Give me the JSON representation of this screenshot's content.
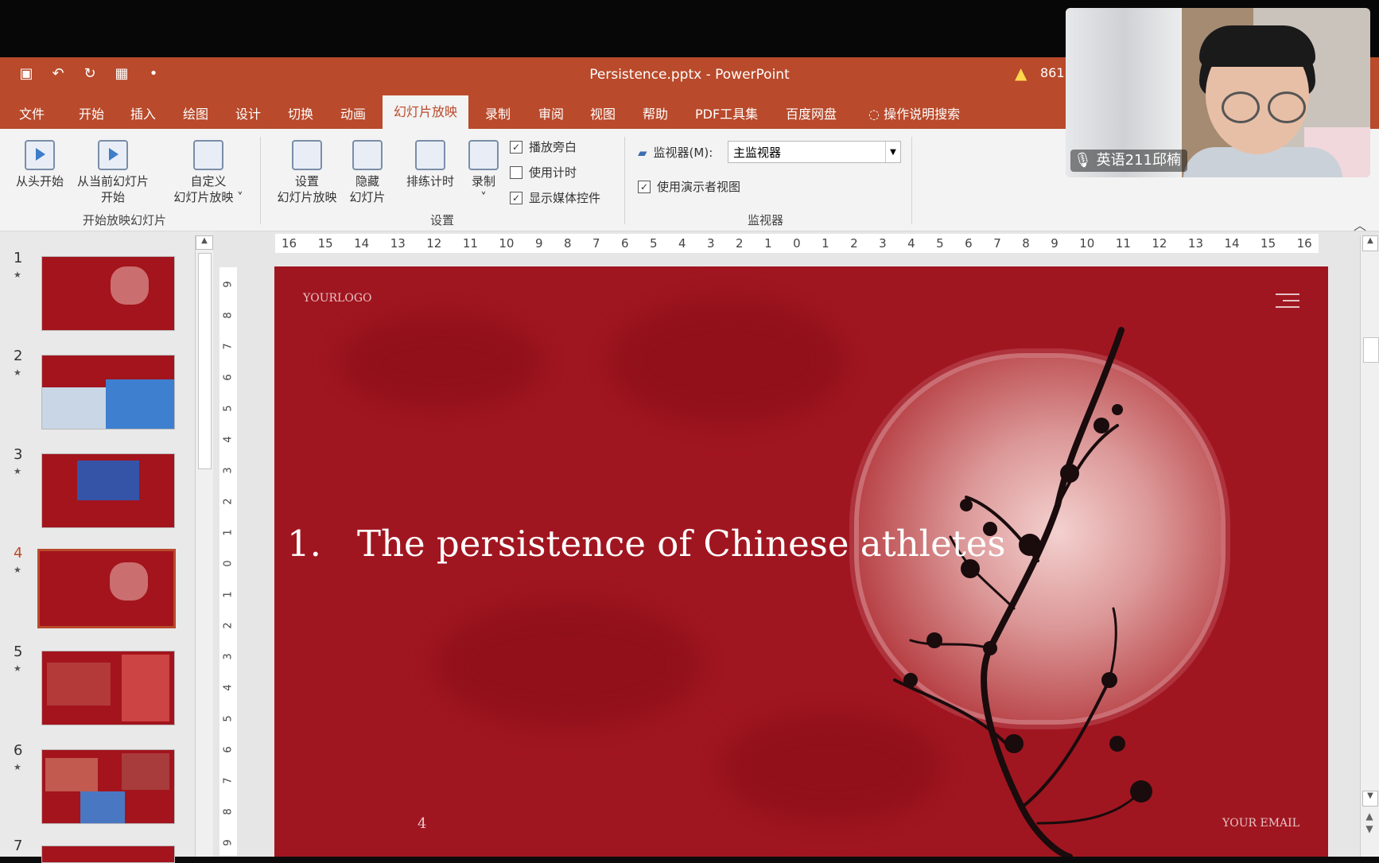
{
  "app": {
    "window_title": "Persistence.pptx - PowerPoint",
    "warning_count": "861"
  },
  "tabs": [
    "文件",
    "开始",
    "插入",
    "绘图",
    "设计",
    "切换",
    "动画",
    "幻灯片放映",
    "录制",
    "审阅",
    "视图",
    "帮助",
    "PDF工具集",
    "百度网盘",
    "操作说明搜索"
  ],
  "ribbon": {
    "start_group": {
      "label": "开始放映幻灯片",
      "from_beginning": "从头开始",
      "from_current_line1": "从当前幻灯片",
      "from_current_line2": "开始",
      "custom_line1": "自定义",
      "custom_line2": "幻灯片放映"
    },
    "setup_group": {
      "label": "设置",
      "setup_line1": "设置",
      "setup_line2": "幻灯片放映",
      "hide_line1": "隐藏",
      "hide_line2": "幻灯片",
      "rehearse": "排练计时",
      "record": "录制",
      "check_narration": "播放旁白",
      "check_timings": "使用计时",
      "check_media": "显示媒体控件"
    },
    "monitor_group": {
      "label": "监视器",
      "monitor_label": "监视器(M):",
      "monitor_value": "主监视器",
      "presenter_view": "使用演示者视图"
    }
  },
  "thumbnails": [
    {
      "num": "1",
      "selected": false
    },
    {
      "num": "2",
      "selected": false
    },
    {
      "num": "3",
      "selected": false
    },
    {
      "num": "4",
      "selected": true
    },
    {
      "num": "5",
      "selected": false
    },
    {
      "num": "6",
      "selected": false
    },
    {
      "num": "7",
      "selected": false
    }
  ],
  "ruler": {
    "horizontal": [
      "16",
      "15",
      "14",
      "13",
      "12",
      "11",
      "10",
      "9",
      "8",
      "7",
      "6",
      "5",
      "4",
      "3",
      "2",
      "1",
      "0",
      "1",
      "2",
      "3",
      "4",
      "5",
      "6",
      "7",
      "8",
      "9",
      "10",
      "11",
      "12",
      "13",
      "14",
      "15",
      "16"
    ],
    "vertical": [
      "9",
      "8",
      "7",
      "6",
      "5",
      "4",
      "3",
      "2",
      "1",
      "0",
      "1",
      "2",
      "3",
      "4",
      "5",
      "6",
      "7",
      "8",
      "9"
    ]
  },
  "slide": {
    "logo": "YOURLOGO",
    "title_number": "1.",
    "title_text": "The persistence of Chinese athletes",
    "page_number": "4",
    "footer": "YOUR EMAIL"
  },
  "webcam": {
    "participant": "英语211邱楠"
  },
  "colors": {
    "accent": "#b94a2b",
    "slide_bg": "#a01620"
  }
}
